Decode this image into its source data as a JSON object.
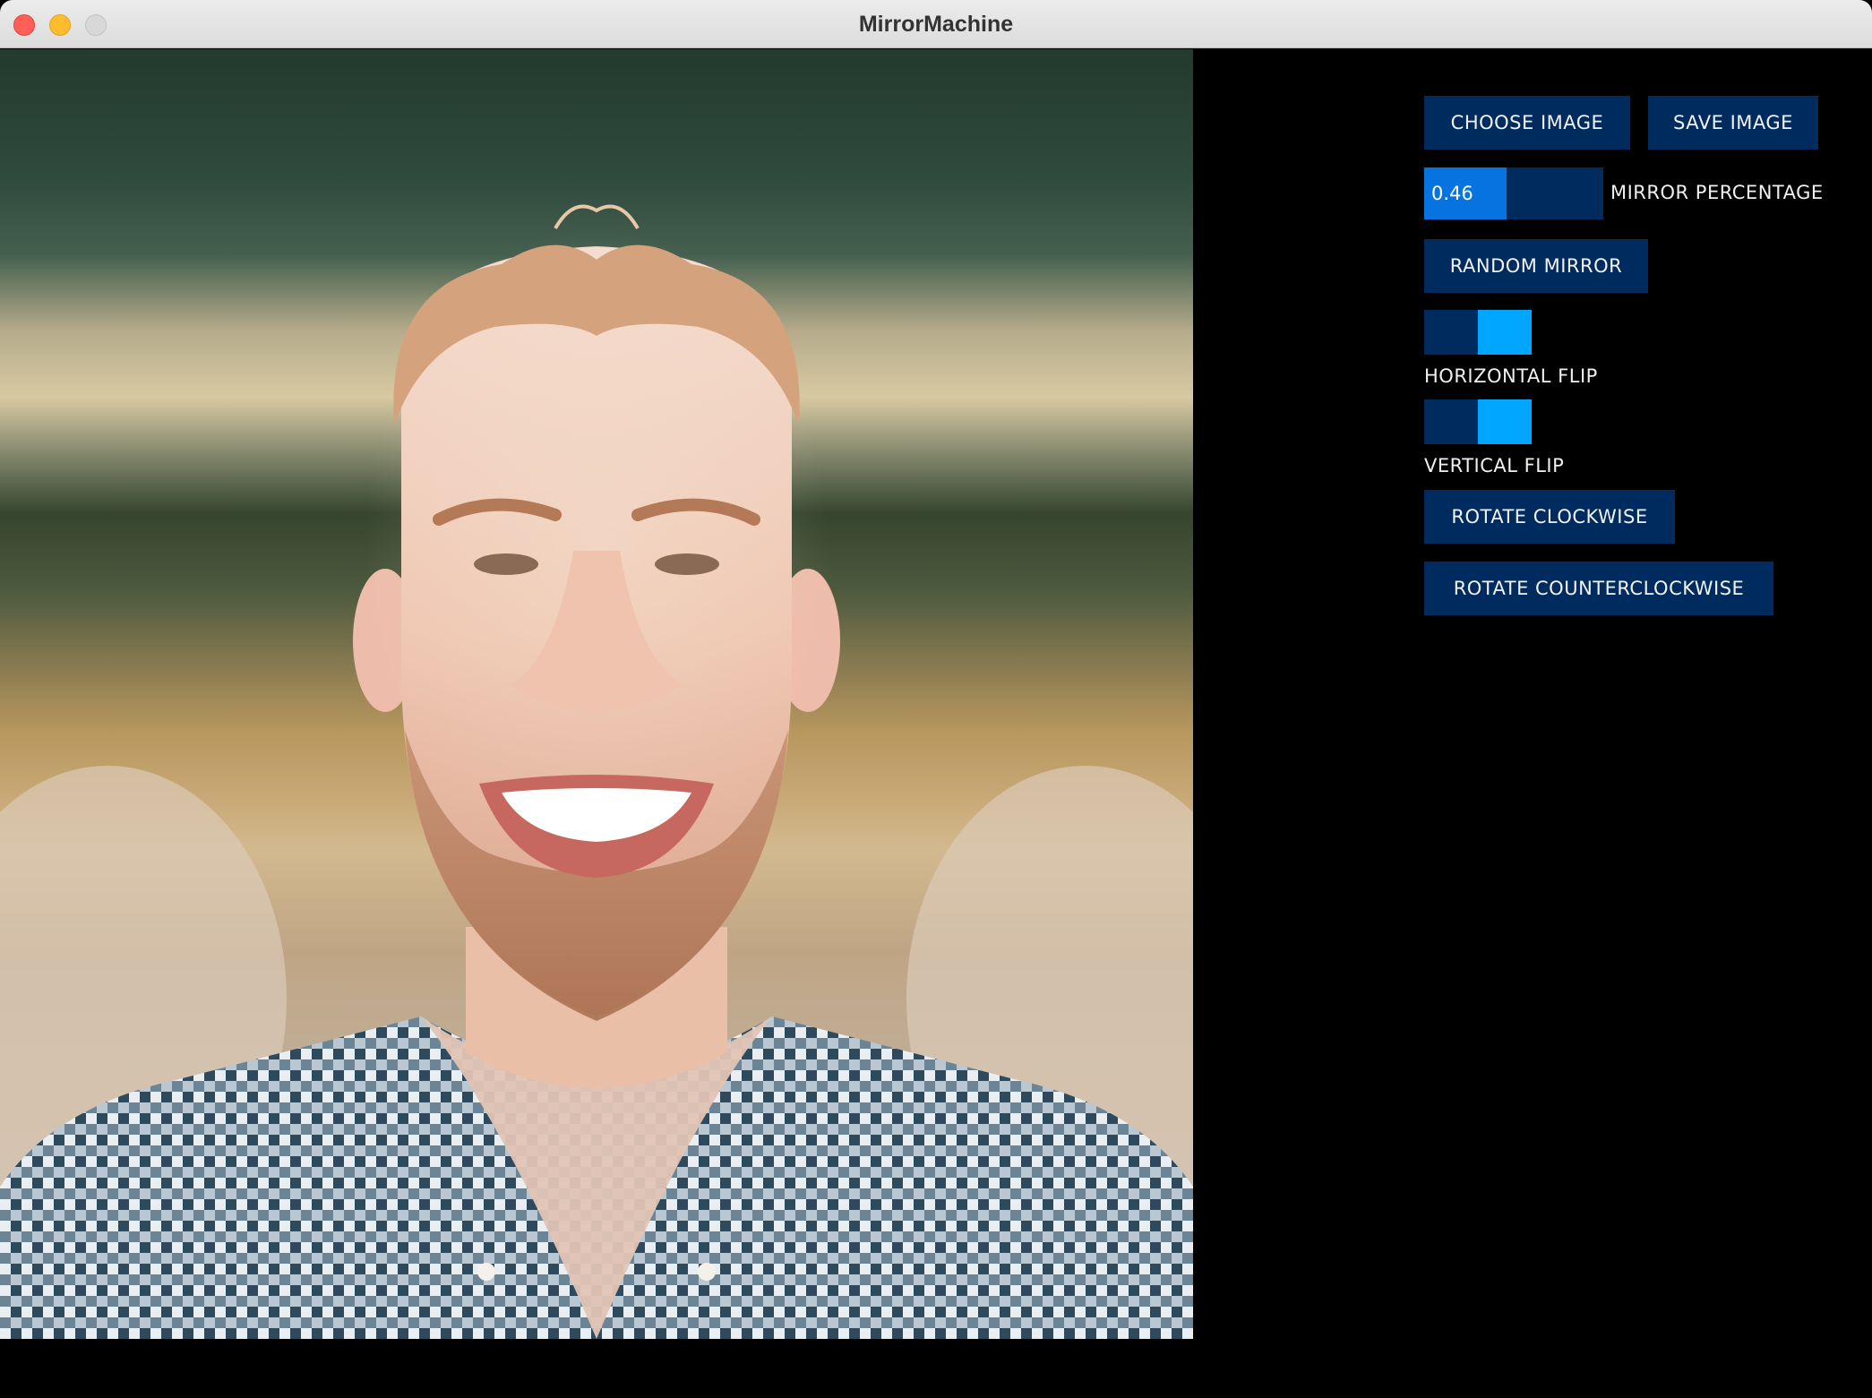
{
  "window": {
    "title": "MirrorMachine"
  },
  "image": {
    "description_icon": "mirrored-portrait-image"
  },
  "controls": {
    "choose_image_label": "CHOOSE IMAGE",
    "save_image_label": "SAVE IMAGE",
    "mirror_percentage": {
      "value": 0.46,
      "value_text": "0.46",
      "label": "MIRROR PERCENTAGE"
    },
    "random_mirror_label": "RANDOM MIRROR",
    "horizontal_flip": {
      "label": "HORIZONTAL FLIP",
      "on": true
    },
    "vertical_flip": {
      "label": "VERTICAL FLIP",
      "on": true
    },
    "rotate_clockwise_label": "ROTATE CLOCKWISE",
    "rotate_counterclockwise_label": "ROTATE COUNTERCLOCKWISE"
  },
  "colors": {
    "button_bg": "#002b5e",
    "slider_fill": "#0673e0",
    "toggle_on": "#00a6ff",
    "background": "#000000"
  }
}
